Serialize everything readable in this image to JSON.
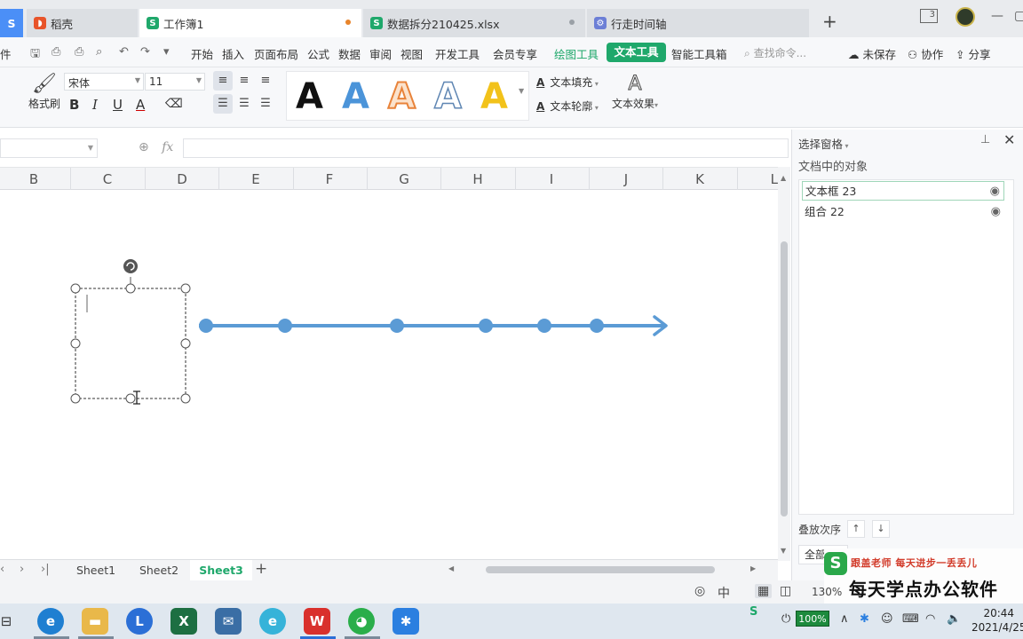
{
  "tabs": {
    "wps": "S",
    "daoke": "稻壳",
    "workbook": "工作簿1",
    "data": "数据拆分210425.xlsx",
    "timeline": "行走时间轴",
    "new_tab": "+"
  },
  "window": {
    "tab_count": "3"
  },
  "menubar": {
    "file": "件",
    "items": [
      "开始",
      "插入",
      "页面布局",
      "公式",
      "数据",
      "审阅",
      "视图",
      "开发工具",
      "会员专享"
    ],
    "draw_tools": "绘图工具",
    "text_tools": "文本工具",
    "smart_box": "智能工具箱",
    "search_placeholder": "查找命令...",
    "unsaved": "未保存",
    "collab": "协作",
    "share": "分享"
  },
  "ribbon": {
    "format_painter": "格式刷",
    "font_name": "宋体",
    "font_size": "11",
    "bold": "B",
    "italic": "I",
    "underline": "U",
    "font_color": "A",
    "wordart_letter": "A",
    "text_fill": "文本填充",
    "text_outline": "文本轮廓",
    "text_effect": "文本效果"
  },
  "formulabar": {
    "fx": "fx",
    "value": ""
  },
  "columns": [
    "B",
    "C",
    "D",
    "E",
    "F",
    "G",
    "H",
    "I",
    "J",
    "K",
    "L"
  ],
  "timeline": {
    "line_color": "#5b9bd5",
    "points_count": 6
  },
  "selection_pane": {
    "title": "选择窗格",
    "subtitle": "文档中的对象",
    "objects": [
      "文本框 23",
      "组合 22"
    ],
    "order_label": "叠放次序",
    "show_all": "全部显示"
  },
  "sheets": [
    "Sheet1",
    "Sheet2",
    "Sheet3"
  ],
  "active_sheet": "Sheet3",
  "status": {
    "zoom": "130%"
  },
  "watermark": {
    "top": "跟盖老师  每天进步一丢丢儿",
    "bottom": "每天学点办公软件"
  },
  "taskbar": {
    "battery": "100%",
    "time": "20:44",
    "date": "2021/4/25"
  },
  "colors": {
    "accent": "#1fa86b",
    "timeline": "#5b9bd5"
  }
}
